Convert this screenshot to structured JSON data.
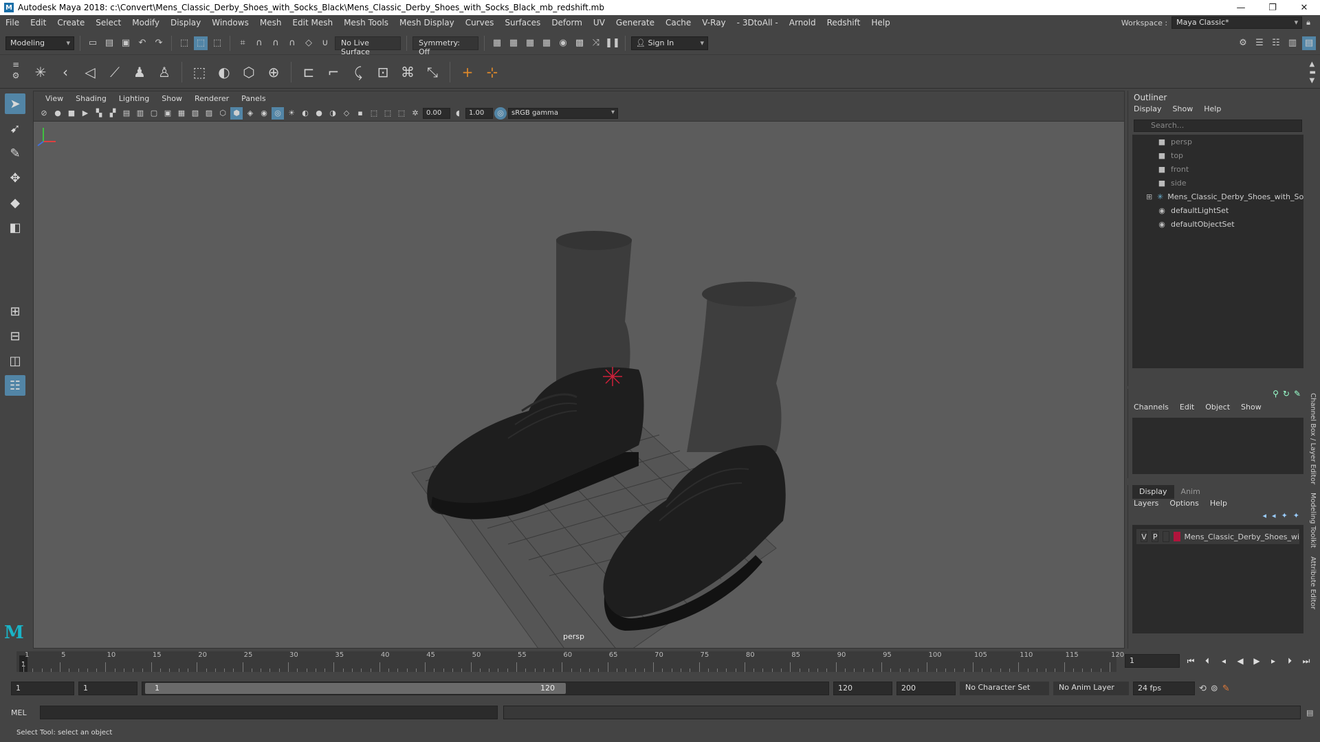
{
  "window": {
    "title": "Autodesk Maya 2018: c:\\Convert\\Mens_Classic_Derby_Shoes_with_Socks_Black\\Mens_Classic_Derby_Shoes_with_Socks_Black_mb_redshift.mb",
    "app_icon": "M",
    "minimize": "—",
    "maximize": "❐",
    "close": "✕"
  },
  "menubar": {
    "items": [
      "File",
      "Edit",
      "Create",
      "Select",
      "Modify",
      "Display",
      "Windows",
      "Mesh",
      "Edit Mesh",
      "Mesh Tools",
      "Mesh Display",
      "Curves",
      "Surfaces",
      "Deform",
      "UV",
      "Generate",
      "Cache",
      "V-Ray",
      "- 3DtoAll -",
      "Arnold",
      "Redshift",
      "Help"
    ],
    "workspace_label": "Workspace :",
    "workspace_value": "Maya Classic*"
  },
  "statusline": {
    "mode": "Modeling",
    "live_surface": "No Live Surface",
    "symmetry": "Symmetry: Off",
    "sign_in": "Sign In"
  },
  "viewport": {
    "menu": [
      "View",
      "Shading",
      "Lighting",
      "Show",
      "Renderer",
      "Panels"
    ],
    "exposure": "0.00",
    "gamma": "1.00",
    "color_space": "sRGB gamma",
    "camera_label": "persp"
  },
  "outliner": {
    "title": "Outliner",
    "menu": [
      "Display",
      "Show",
      "Help"
    ],
    "search_placeholder": "Search...",
    "items": [
      {
        "label": "persp",
        "icon": "camera-icon",
        "dim": true
      },
      {
        "label": "top",
        "icon": "camera-icon",
        "dim": true
      },
      {
        "label": "front",
        "icon": "camera-icon",
        "dim": true
      },
      {
        "label": "side",
        "icon": "camera-icon",
        "dim": true
      },
      {
        "label": "Mens_Classic_Derby_Shoes_with_Socks_",
        "icon": "group-icon",
        "dim": false,
        "expandable": true
      },
      {
        "label": "defaultLightSet",
        "icon": "set-icon",
        "dim": false
      },
      {
        "label": "defaultObjectSet",
        "icon": "set-icon",
        "dim": false
      }
    ]
  },
  "channelbox": {
    "menu": [
      "Channels",
      "Edit",
      "Object",
      "Show"
    ]
  },
  "layereditor": {
    "tabs": [
      "Display",
      "Anim"
    ],
    "menu": [
      "Layers",
      "Options",
      "Help"
    ],
    "layer": {
      "v": "V",
      "p": "P",
      "name": "Mens_Classic_Derby_Shoes_wi",
      "color": "#b0143c"
    }
  },
  "side_tabs": [
    "Channel Box / Layer Editor",
    "Modeling Toolkit",
    "Attribute Editor"
  ],
  "timeslider": {
    "ticks": [
      1,
      5,
      10,
      15,
      20,
      25,
      30,
      35,
      40,
      45,
      50,
      55,
      60,
      65,
      70,
      75,
      80,
      85,
      90,
      95,
      100,
      105,
      110,
      115,
      120
    ],
    "current_frame": "1",
    "current_frame_field": "1"
  },
  "rangeslider": {
    "start": "1",
    "playback_start": "1",
    "range_start_label": "1",
    "range_end_label": "120",
    "playback_end": "120",
    "end": "200",
    "character_set": "No Character Set",
    "anim_layer": "No Anim Layer",
    "fps": "24 fps"
  },
  "cmdline": {
    "language": "MEL"
  },
  "helpline": {
    "text": "Select Tool: select an object"
  },
  "colors": {
    "accent": "#5285a6",
    "maya_logo": "#1ab3c6",
    "layer_color": "#b0143c"
  }
}
